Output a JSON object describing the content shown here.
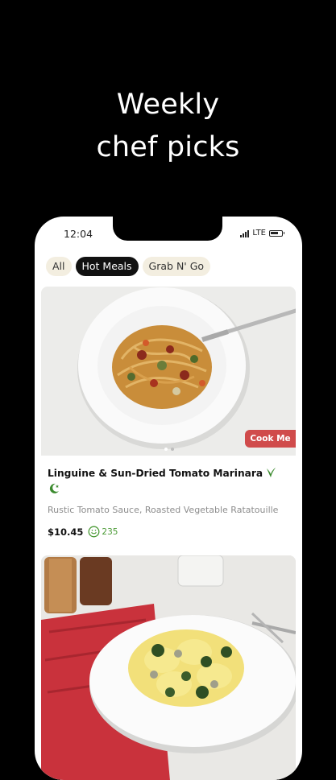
{
  "promo": {
    "headline_line1": "Weekly",
    "headline_line2": "chef picks"
  },
  "status_bar": {
    "time": "12:04",
    "network": "LTE"
  },
  "filter_tabs": [
    {
      "label": "All",
      "active": false
    },
    {
      "label": "Hot Meals",
      "active": true
    },
    {
      "label": "Grab N' Go",
      "active": false
    }
  ],
  "meal_card": {
    "badge": "Cook Me",
    "title": "Linguine & Sun-Dried Tomato Marinara",
    "description": "Rustic Tomato Sauce, Roasted Vegetable Ratatouille",
    "price": "$10.45",
    "points": "235",
    "image_dots": 2,
    "active_dot": 0,
    "icons": [
      "vegetarian-leaf-icon",
      "halal-crescent-icon",
      "smile-points-icon"
    ]
  },
  "colors": {
    "badge_red": "#d04b4b",
    "tab_bg": "#f3eee0",
    "tab_active_bg": "#111111",
    "points_green": "#4a9a35",
    "veg_green": "#3b8a2e"
  }
}
